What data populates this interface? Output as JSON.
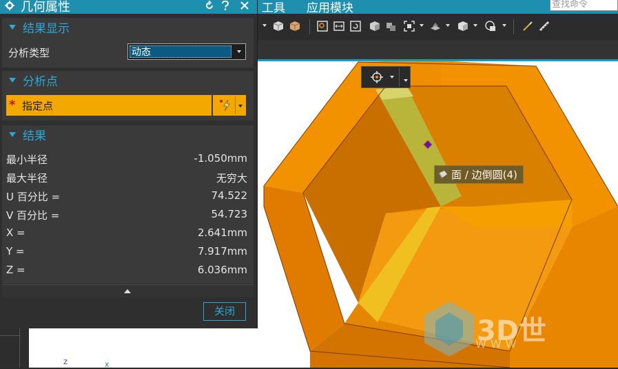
{
  "menubar": {
    "items": [
      "工具",
      "应用模块"
    ],
    "search_placeholder": "查找命令"
  },
  "dialog": {
    "title": "几何属性",
    "title_icons": [
      "gear-icon",
      "reset-icon",
      "help-icon",
      "close-icon"
    ],
    "sections": {
      "display": {
        "label": "结果显示",
        "analysis_type_label": "分析类型",
        "analysis_type_value": "动态"
      },
      "point": {
        "label": "分析点",
        "specify_label": "指定点"
      },
      "result": {
        "label": "结果",
        "rows": [
          {
            "key": "最小半径",
            "value": "-1.050mm"
          },
          {
            "key": "最大半径",
            "value": "无穷大"
          },
          {
            "key": "U 百分比 =",
            "value": "74.522"
          },
          {
            "key": "V 百分比 =",
            "value": "54.723"
          },
          {
            "key": "X =",
            "value": "2.641mm"
          },
          {
            "key": "Y =",
            "value": "7.917mm"
          },
          {
            "key": "Z =",
            "value": "6.036mm"
          }
        ]
      }
    },
    "close_label": "关闭"
  },
  "viewport": {
    "tooltip": "面 / 边倒圆(4)",
    "watermark": "3D世",
    "watermark_sub": "WWW",
    "axis_labels": [
      "Z",
      "X"
    ]
  },
  "colors": {
    "accent": "#1f8fb0",
    "section_label": "#2ea6d6",
    "part_orange": "#f39200",
    "selected_face": "#b9b43a",
    "point_fill": "#f2a800"
  }
}
